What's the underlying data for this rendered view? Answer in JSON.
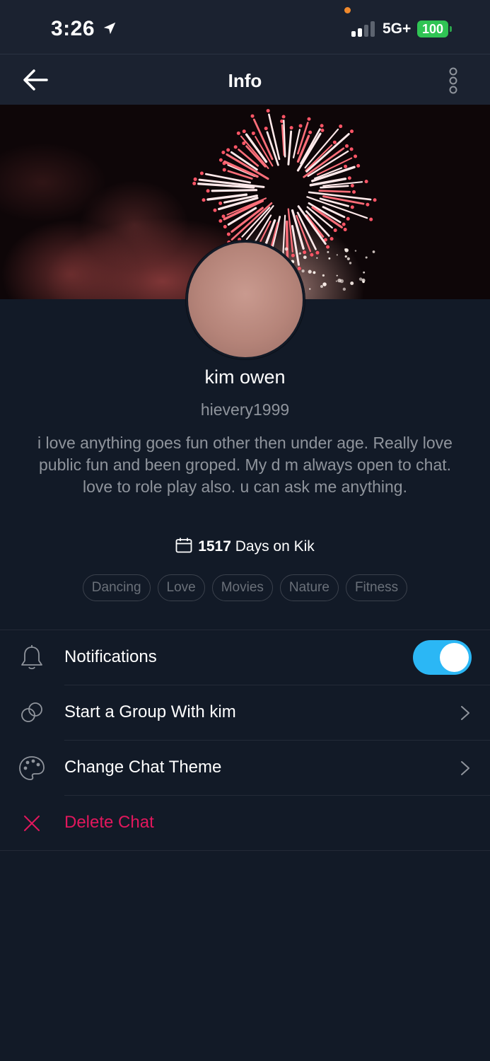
{
  "status_bar": {
    "time": "3:26",
    "network": "5G+",
    "battery": "100",
    "location_icon": "location-arrow-icon",
    "recording_indicator_color": "#f0892c"
  },
  "header": {
    "title": "Info",
    "back_icon": "arrow-left-icon",
    "more_icon": "more-vertical-icon"
  },
  "profile": {
    "display_name": "kim owen",
    "username": "hievery1999",
    "bio": "i love anything goes fun other then under age. Really love public fun and been groped. My d m always open to chat. love to role play also.  u can ask me anything.",
    "days_count": "1517",
    "days_label": "Days on Kik",
    "tags": [
      "Dancing",
      "Love",
      "Movies",
      "Nature",
      "Fitness"
    ]
  },
  "settings": {
    "notifications_label": "Notifications",
    "notifications_on": true,
    "group_label": "Start a Group With kim",
    "theme_label": "Change Chat Theme",
    "delete_label": "Delete Chat"
  },
  "colors": {
    "background": "#121a27",
    "header": "#1b2230",
    "toggle_on": "#2bb7f5",
    "danger": "#e2175d",
    "muted_text": "#8f949c",
    "battery": "#30c454"
  }
}
